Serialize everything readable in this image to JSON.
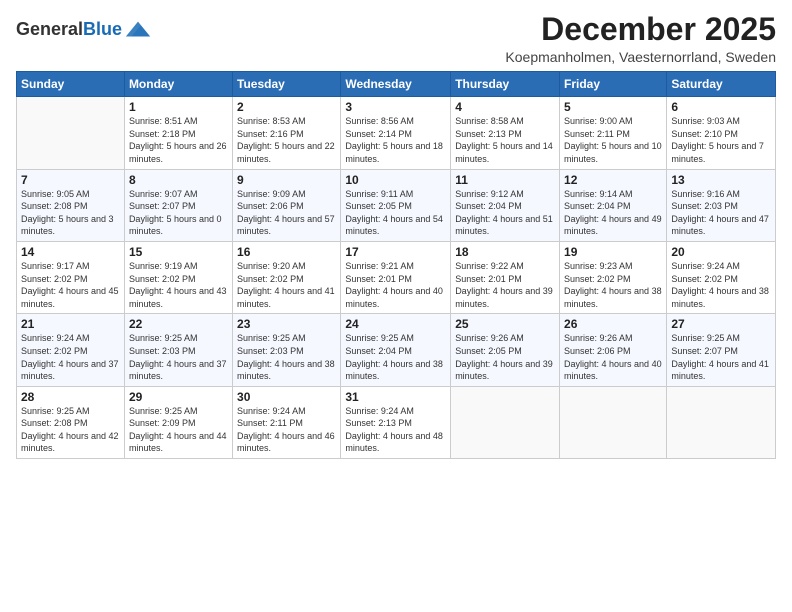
{
  "header": {
    "logo_general": "General",
    "logo_blue": "Blue",
    "month_title": "December 2025",
    "location": "Koepmanholmen, Vaesternorrland, Sweden"
  },
  "days_of_week": [
    "Sunday",
    "Monday",
    "Tuesday",
    "Wednesday",
    "Thursday",
    "Friday",
    "Saturday"
  ],
  "weeks": [
    [
      {
        "day": "",
        "sunrise": "",
        "sunset": "",
        "daylight": ""
      },
      {
        "day": "1",
        "sunrise": "Sunrise: 8:51 AM",
        "sunset": "Sunset: 2:18 PM",
        "daylight": "Daylight: 5 hours and 26 minutes."
      },
      {
        "day": "2",
        "sunrise": "Sunrise: 8:53 AM",
        "sunset": "Sunset: 2:16 PM",
        "daylight": "Daylight: 5 hours and 22 minutes."
      },
      {
        "day": "3",
        "sunrise": "Sunrise: 8:56 AM",
        "sunset": "Sunset: 2:14 PM",
        "daylight": "Daylight: 5 hours and 18 minutes."
      },
      {
        "day": "4",
        "sunrise": "Sunrise: 8:58 AM",
        "sunset": "Sunset: 2:13 PM",
        "daylight": "Daylight: 5 hours and 14 minutes."
      },
      {
        "day": "5",
        "sunrise": "Sunrise: 9:00 AM",
        "sunset": "Sunset: 2:11 PM",
        "daylight": "Daylight: 5 hours and 10 minutes."
      },
      {
        "day": "6",
        "sunrise": "Sunrise: 9:03 AM",
        "sunset": "Sunset: 2:10 PM",
        "daylight": "Daylight: 5 hours and 7 minutes."
      }
    ],
    [
      {
        "day": "7",
        "sunrise": "Sunrise: 9:05 AM",
        "sunset": "Sunset: 2:08 PM",
        "daylight": "Daylight: 5 hours and 3 minutes."
      },
      {
        "day": "8",
        "sunrise": "Sunrise: 9:07 AM",
        "sunset": "Sunset: 2:07 PM",
        "daylight": "Daylight: 5 hours and 0 minutes."
      },
      {
        "day": "9",
        "sunrise": "Sunrise: 9:09 AM",
        "sunset": "Sunset: 2:06 PM",
        "daylight": "Daylight: 4 hours and 57 minutes."
      },
      {
        "day": "10",
        "sunrise": "Sunrise: 9:11 AM",
        "sunset": "Sunset: 2:05 PM",
        "daylight": "Daylight: 4 hours and 54 minutes."
      },
      {
        "day": "11",
        "sunrise": "Sunrise: 9:12 AM",
        "sunset": "Sunset: 2:04 PM",
        "daylight": "Daylight: 4 hours and 51 minutes."
      },
      {
        "day": "12",
        "sunrise": "Sunrise: 9:14 AM",
        "sunset": "Sunset: 2:04 PM",
        "daylight": "Daylight: 4 hours and 49 minutes."
      },
      {
        "day": "13",
        "sunrise": "Sunrise: 9:16 AM",
        "sunset": "Sunset: 2:03 PM",
        "daylight": "Daylight: 4 hours and 47 minutes."
      }
    ],
    [
      {
        "day": "14",
        "sunrise": "Sunrise: 9:17 AM",
        "sunset": "Sunset: 2:02 PM",
        "daylight": "Daylight: 4 hours and 45 minutes."
      },
      {
        "day": "15",
        "sunrise": "Sunrise: 9:19 AM",
        "sunset": "Sunset: 2:02 PM",
        "daylight": "Daylight: 4 hours and 43 minutes."
      },
      {
        "day": "16",
        "sunrise": "Sunrise: 9:20 AM",
        "sunset": "Sunset: 2:02 PM",
        "daylight": "Daylight: 4 hours and 41 minutes."
      },
      {
        "day": "17",
        "sunrise": "Sunrise: 9:21 AM",
        "sunset": "Sunset: 2:01 PM",
        "daylight": "Daylight: 4 hours and 40 minutes."
      },
      {
        "day": "18",
        "sunrise": "Sunrise: 9:22 AM",
        "sunset": "Sunset: 2:01 PM",
        "daylight": "Daylight: 4 hours and 39 minutes."
      },
      {
        "day": "19",
        "sunrise": "Sunrise: 9:23 AM",
        "sunset": "Sunset: 2:02 PM",
        "daylight": "Daylight: 4 hours and 38 minutes."
      },
      {
        "day": "20",
        "sunrise": "Sunrise: 9:24 AM",
        "sunset": "Sunset: 2:02 PM",
        "daylight": "Daylight: 4 hours and 38 minutes."
      }
    ],
    [
      {
        "day": "21",
        "sunrise": "Sunrise: 9:24 AM",
        "sunset": "Sunset: 2:02 PM",
        "daylight": "Daylight: 4 hours and 37 minutes."
      },
      {
        "day": "22",
        "sunrise": "Sunrise: 9:25 AM",
        "sunset": "Sunset: 2:03 PM",
        "daylight": "Daylight: 4 hours and 37 minutes."
      },
      {
        "day": "23",
        "sunrise": "Sunrise: 9:25 AM",
        "sunset": "Sunset: 2:03 PM",
        "daylight": "Daylight: 4 hours and 38 minutes."
      },
      {
        "day": "24",
        "sunrise": "Sunrise: 9:25 AM",
        "sunset": "Sunset: 2:04 PM",
        "daylight": "Daylight: 4 hours and 38 minutes."
      },
      {
        "day": "25",
        "sunrise": "Sunrise: 9:26 AM",
        "sunset": "Sunset: 2:05 PM",
        "daylight": "Daylight: 4 hours and 39 minutes."
      },
      {
        "day": "26",
        "sunrise": "Sunrise: 9:26 AM",
        "sunset": "Sunset: 2:06 PM",
        "daylight": "Daylight: 4 hours and 40 minutes."
      },
      {
        "day": "27",
        "sunrise": "Sunrise: 9:25 AM",
        "sunset": "Sunset: 2:07 PM",
        "daylight": "Daylight: 4 hours and 41 minutes."
      }
    ],
    [
      {
        "day": "28",
        "sunrise": "Sunrise: 9:25 AM",
        "sunset": "Sunset: 2:08 PM",
        "daylight": "Daylight: 4 hours and 42 minutes."
      },
      {
        "day": "29",
        "sunrise": "Sunrise: 9:25 AM",
        "sunset": "Sunset: 2:09 PM",
        "daylight": "Daylight: 4 hours and 44 minutes."
      },
      {
        "day": "30",
        "sunrise": "Sunrise: 9:24 AM",
        "sunset": "Sunset: 2:11 PM",
        "daylight": "Daylight: 4 hours and 46 minutes."
      },
      {
        "day": "31",
        "sunrise": "Sunrise: 9:24 AM",
        "sunset": "Sunset: 2:13 PM",
        "daylight": "Daylight: 4 hours and 48 minutes."
      },
      {
        "day": "",
        "sunrise": "",
        "sunset": "",
        "daylight": ""
      },
      {
        "day": "",
        "sunrise": "",
        "sunset": "",
        "daylight": ""
      },
      {
        "day": "",
        "sunrise": "",
        "sunset": "",
        "daylight": ""
      }
    ]
  ]
}
